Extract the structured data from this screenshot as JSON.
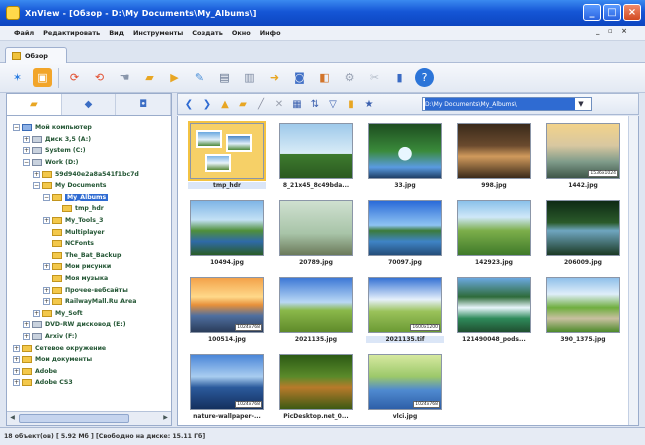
{
  "window": {
    "title": "XnView - [Обзор - D:\\My Documents\\My_Albums\\]",
    "buttons": {
      "minimize": "_",
      "maximize": "□",
      "close": "×"
    }
  },
  "menu": {
    "items": [
      "Файл",
      "Редактировать",
      "Вид",
      "Инструменты",
      "Создать",
      "Окно",
      "Инфо"
    ],
    "mdi_controls": "_ ▫ ×"
  },
  "tab": {
    "label": "Обзор"
  },
  "toolbar_icons": [
    "star-icon",
    "browser-icon",
    "refresh-icon",
    "refresh-alt-icon",
    "hand-icon",
    "open-folder-icon",
    "folder-arrow-icon",
    "edit-icon",
    "print-icon",
    "scan-icon",
    "export-icon",
    "slideshow-icon",
    "batch-icon",
    "settings-icon",
    "info-icon",
    "help-icon"
  ],
  "left_panel": {
    "tab_icons": [
      "folder-tab-icon",
      "favorites-tab-icon",
      "category-tab-icon"
    ],
    "tree": [
      {
        "label": "Мой компьютер",
        "level": 0,
        "type": "pc",
        "expander": "−"
      },
      {
        "label": "Диск 3,5 (A:)",
        "level": 1,
        "type": "drive",
        "expander": "+"
      },
      {
        "label": "System (C:)",
        "level": 1,
        "type": "drive",
        "expander": "+"
      },
      {
        "label": "Work (D:)",
        "level": 1,
        "type": "drive",
        "expander": "−"
      },
      {
        "label": "59d940e2a8a541f1bc7d",
        "level": 2,
        "type": "folder",
        "expander": "+"
      },
      {
        "label": "My Documents",
        "level": 2,
        "type": "folder",
        "expander": "−"
      },
      {
        "label": "My_Albums",
        "level": 3,
        "type": "folder",
        "expander": "−",
        "selected": true
      },
      {
        "label": "tmp_hdr",
        "level": 4,
        "type": "folder",
        "expander": ""
      },
      {
        "label": "My_Tools_3",
        "level": 3,
        "type": "folder",
        "expander": "+"
      },
      {
        "label": "Multiplayer",
        "level": 3,
        "type": "folder",
        "expander": ""
      },
      {
        "label": "NCFonts",
        "level": 3,
        "type": "folder",
        "expander": ""
      },
      {
        "label": "The_Bat_Backup",
        "level": 3,
        "type": "folder",
        "expander": ""
      },
      {
        "label": "Мои рисунки",
        "level": 3,
        "type": "folder",
        "expander": "+"
      },
      {
        "label": "Моя музыка",
        "level": 3,
        "type": "folder",
        "expander": ""
      },
      {
        "label": "Прочее-вебсайты",
        "level": 3,
        "type": "folder",
        "expander": "+"
      },
      {
        "label": "RailwayMall.Ru Area",
        "level": 3,
        "type": "folder",
        "expander": "+"
      },
      {
        "label": "My_Soft",
        "level": 2,
        "type": "folder",
        "expander": "+"
      },
      {
        "label": "DVD-RW дисковод (E:)",
        "level": 1,
        "type": "drive",
        "expander": "+"
      },
      {
        "label": "Arxiv (F:)",
        "level": 1,
        "type": "drive",
        "expander": "+"
      },
      {
        "label": "Сетевое окружение",
        "level": 0,
        "type": "folder",
        "expander": "+"
      },
      {
        "label": "Мои документы",
        "level": 0,
        "type": "folder",
        "expander": "+"
      },
      {
        "label": "Adobe",
        "level": 0,
        "type": "folder",
        "expander": "+"
      },
      {
        "label": "Adobe CS3",
        "level": 0,
        "type": "folder",
        "expander": "+"
      }
    ]
  },
  "browser": {
    "nav_icons": [
      "back-icon",
      "forward-icon",
      "up-folder-icon",
      "new-folder-icon",
      "edit-icon",
      "delete-icon",
      "view-mode-icon",
      "sort-icon",
      "filter-icon",
      "favorites-icon",
      "star-icon"
    ],
    "path": "D:\\My Documents\\My_Albums\\",
    "thumbnails": [
      {
        "name": "tmp_hdr",
        "kind": "folder",
        "selected": true,
        "badge": ""
      },
      {
        "name": "8_21x45_8c49bda...",
        "kind": "silhouette",
        "badge": ""
      },
      {
        "name": "33.jpg",
        "kind": "waterfall",
        "badge": ""
      },
      {
        "name": "998.jpg",
        "kind": "portrait",
        "badge": ""
      },
      {
        "name": "1442.jpg",
        "kind": "misty",
        "badge": "1536x1024"
      },
      {
        "name": "10494.jpg",
        "kind": "river",
        "badge": ""
      },
      {
        "name": "20789.jpg",
        "kind": "duck",
        "badge": ""
      },
      {
        "name": "70097.jpg",
        "kind": "lake",
        "badge": ""
      },
      {
        "name": "142923.jpg",
        "kind": "valley",
        "badge": ""
      },
      {
        "name": "206009.jpg",
        "kind": "pond",
        "badge": ""
      },
      {
        "name": "100514.jpg",
        "kind": "sunset",
        "badge": "1024x768"
      },
      {
        "name": "2021135.jpg",
        "kind": "field",
        "badge": ""
      },
      {
        "name": "2021135.tif",
        "kind": "clouds",
        "badge": "1600x1200",
        "highlight": true
      },
      {
        "name": "121490048_pods...",
        "kind": "cascade",
        "badge": ""
      },
      {
        "name": "390_1375.jpg",
        "kind": "path",
        "badge": ""
      },
      {
        "name": "nature-wallpaper-...",
        "kind": "blue-lake",
        "badge": "1024x768"
      },
      {
        "name": "PicDesktop.net_0...",
        "kind": "forest",
        "badge": ""
      },
      {
        "name": "vlci.jpg",
        "kind": "bright-lake",
        "badge": "1024x768"
      }
    ]
  },
  "status": {
    "text": "18 объект(ов) [ 5.92 Мб ] [Свободно на диске: 15.11 Гб]"
  }
}
